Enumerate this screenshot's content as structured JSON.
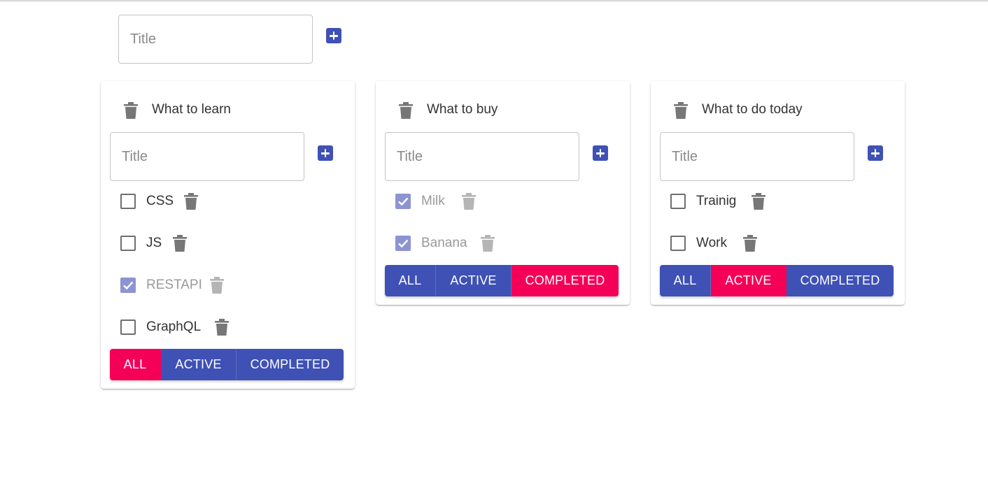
{
  "new_list": {
    "placeholder": "Title",
    "add_icon": "plus-icon"
  },
  "colors": {
    "primary": "#3f51b5",
    "secondary": "#f50057",
    "checked": "#8c94d2"
  },
  "lists": [
    {
      "title": "What to learn",
      "placeholder": "Title",
      "tasks": [
        {
          "label": "CSS",
          "done": false
        },
        {
          "label": "JS",
          "done": false
        },
        {
          "label": "RESTAPI",
          "done": true
        },
        {
          "label": "GraphQL",
          "done": false
        }
      ],
      "filters": [
        "ALL",
        "ACTIVE",
        "COMPLETED"
      ],
      "active_filter": "ALL"
    },
    {
      "title": "What to buy",
      "placeholder": "Title",
      "tasks": [
        {
          "label": "Milk",
          "done": true
        },
        {
          "label": "Banana",
          "done": true
        }
      ],
      "filters": [
        "ALL",
        "ACTIVE",
        "COMPLETED"
      ],
      "active_filter": "COMPLETED"
    },
    {
      "title": "What to do today",
      "placeholder": "Title",
      "tasks": [
        {
          "label": "Trainig",
          "done": false
        },
        {
          "label": "Work",
          "done": false
        }
      ],
      "filters": [
        "ALL",
        "ACTIVE",
        "COMPLETED"
      ],
      "active_filter": "ACTIVE"
    }
  ]
}
